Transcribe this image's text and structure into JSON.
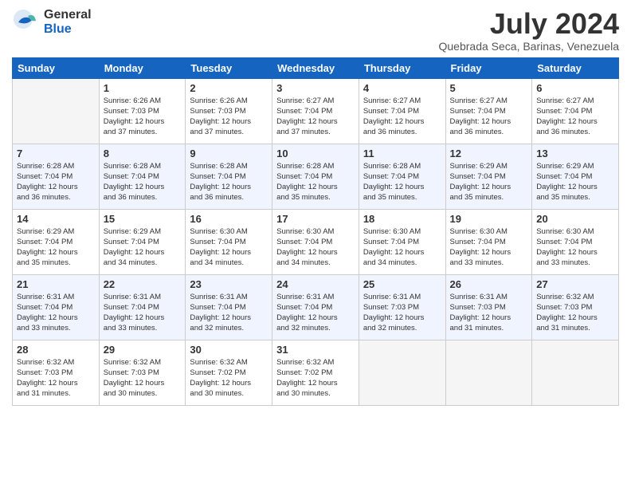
{
  "header": {
    "logo_line1": "General",
    "logo_line2": "Blue",
    "month": "July 2024",
    "location": "Quebrada Seca, Barinas, Venezuela"
  },
  "weekdays": [
    "Sunday",
    "Monday",
    "Tuesday",
    "Wednesday",
    "Thursday",
    "Friday",
    "Saturday"
  ],
  "weeks": [
    [
      {
        "day": "",
        "info": ""
      },
      {
        "day": "1",
        "info": "Sunrise: 6:26 AM\nSunset: 7:03 PM\nDaylight: 12 hours\nand 37 minutes."
      },
      {
        "day": "2",
        "info": "Sunrise: 6:26 AM\nSunset: 7:03 PM\nDaylight: 12 hours\nand 37 minutes."
      },
      {
        "day": "3",
        "info": "Sunrise: 6:27 AM\nSunset: 7:04 PM\nDaylight: 12 hours\nand 37 minutes."
      },
      {
        "day": "4",
        "info": "Sunrise: 6:27 AM\nSunset: 7:04 PM\nDaylight: 12 hours\nand 36 minutes."
      },
      {
        "day": "5",
        "info": "Sunrise: 6:27 AM\nSunset: 7:04 PM\nDaylight: 12 hours\nand 36 minutes."
      },
      {
        "day": "6",
        "info": "Sunrise: 6:27 AM\nSunset: 7:04 PM\nDaylight: 12 hours\nand 36 minutes."
      }
    ],
    [
      {
        "day": "7",
        "info": ""
      },
      {
        "day": "8",
        "info": "Sunrise: 6:28 AM\nSunset: 7:04 PM\nDaylight: 12 hours\nand 36 minutes."
      },
      {
        "day": "9",
        "info": "Sunrise: 6:28 AM\nSunset: 7:04 PM\nDaylight: 12 hours\nand 36 minutes."
      },
      {
        "day": "10",
        "info": "Sunrise: 6:28 AM\nSunset: 7:04 PM\nDaylight: 12 hours\nand 35 minutes."
      },
      {
        "day": "11",
        "info": "Sunrise: 6:28 AM\nSunset: 7:04 PM\nDaylight: 12 hours\nand 35 minutes."
      },
      {
        "day": "12",
        "info": "Sunrise: 6:29 AM\nSunset: 7:04 PM\nDaylight: 12 hours\nand 35 minutes."
      },
      {
        "day": "13",
        "info": "Sunrise: 6:29 AM\nSunset: 7:04 PM\nDaylight: 12 hours\nand 35 minutes."
      }
    ],
    [
      {
        "day": "14",
        "info": ""
      },
      {
        "day": "15",
        "info": "Sunrise: 6:29 AM\nSunset: 7:04 PM\nDaylight: 12 hours\nand 34 minutes."
      },
      {
        "day": "16",
        "info": "Sunrise: 6:30 AM\nSunset: 7:04 PM\nDaylight: 12 hours\nand 34 minutes."
      },
      {
        "day": "17",
        "info": "Sunrise: 6:30 AM\nSunset: 7:04 PM\nDaylight: 12 hours\nand 34 minutes."
      },
      {
        "day": "18",
        "info": "Sunrise: 6:30 AM\nSunset: 7:04 PM\nDaylight: 12 hours\nand 34 minutes."
      },
      {
        "day": "19",
        "info": "Sunrise: 6:30 AM\nSunset: 7:04 PM\nDaylight: 12 hours\nand 33 minutes."
      },
      {
        "day": "20",
        "info": "Sunrise: 6:30 AM\nSunset: 7:04 PM\nDaylight: 12 hours\nand 33 minutes."
      }
    ],
    [
      {
        "day": "21",
        "info": ""
      },
      {
        "day": "22",
        "info": "Sunrise: 6:31 AM\nSunset: 7:04 PM\nDaylight: 12 hours\nand 33 minutes."
      },
      {
        "day": "23",
        "info": "Sunrise: 6:31 AM\nSunset: 7:04 PM\nDaylight: 12 hours\nand 32 minutes."
      },
      {
        "day": "24",
        "info": "Sunrise: 6:31 AM\nSunset: 7:04 PM\nDaylight: 12 hours\nand 32 minutes."
      },
      {
        "day": "25",
        "info": "Sunrise: 6:31 AM\nSunset: 7:03 PM\nDaylight: 12 hours\nand 32 minutes."
      },
      {
        "day": "26",
        "info": "Sunrise: 6:31 AM\nSunset: 7:03 PM\nDaylight: 12 hours\nand 31 minutes."
      },
      {
        "day": "27",
        "info": "Sunrise: 6:32 AM\nSunset: 7:03 PM\nDaylight: 12 hours\nand 31 minutes."
      }
    ],
    [
      {
        "day": "28",
        "info": "Sunrise: 6:32 AM\nSunset: 7:03 PM\nDaylight: 12 hours\nand 31 minutes."
      },
      {
        "day": "29",
        "info": "Sunrise: 6:32 AM\nSunset: 7:03 PM\nDaylight: 12 hours\nand 30 minutes."
      },
      {
        "day": "30",
        "info": "Sunrise: 6:32 AM\nSunset: 7:02 PM\nDaylight: 12 hours\nand 30 minutes."
      },
      {
        "day": "31",
        "info": "Sunrise: 6:32 AM\nSunset: 7:02 PM\nDaylight: 12 hours\nand 30 minutes."
      },
      {
        "day": "",
        "info": ""
      },
      {
        "day": "",
        "info": ""
      },
      {
        "day": "",
        "info": ""
      }
    ]
  ],
  "week1_day7_info": "Sunrise: 6:28 AM\nSunset: 7:04 PM\nDaylight: 12 hours\nand 36 minutes.",
  "week3_day14_info": "Sunrise: 6:29 AM\nSunset: 7:04 PM\nDaylight: 12 hours\nand 35 minutes.",
  "week4_day21_info": "Sunrise: 6:31 AM\nSunset: 7:04 PM\nDaylight: 12 hours\nand 33 minutes."
}
